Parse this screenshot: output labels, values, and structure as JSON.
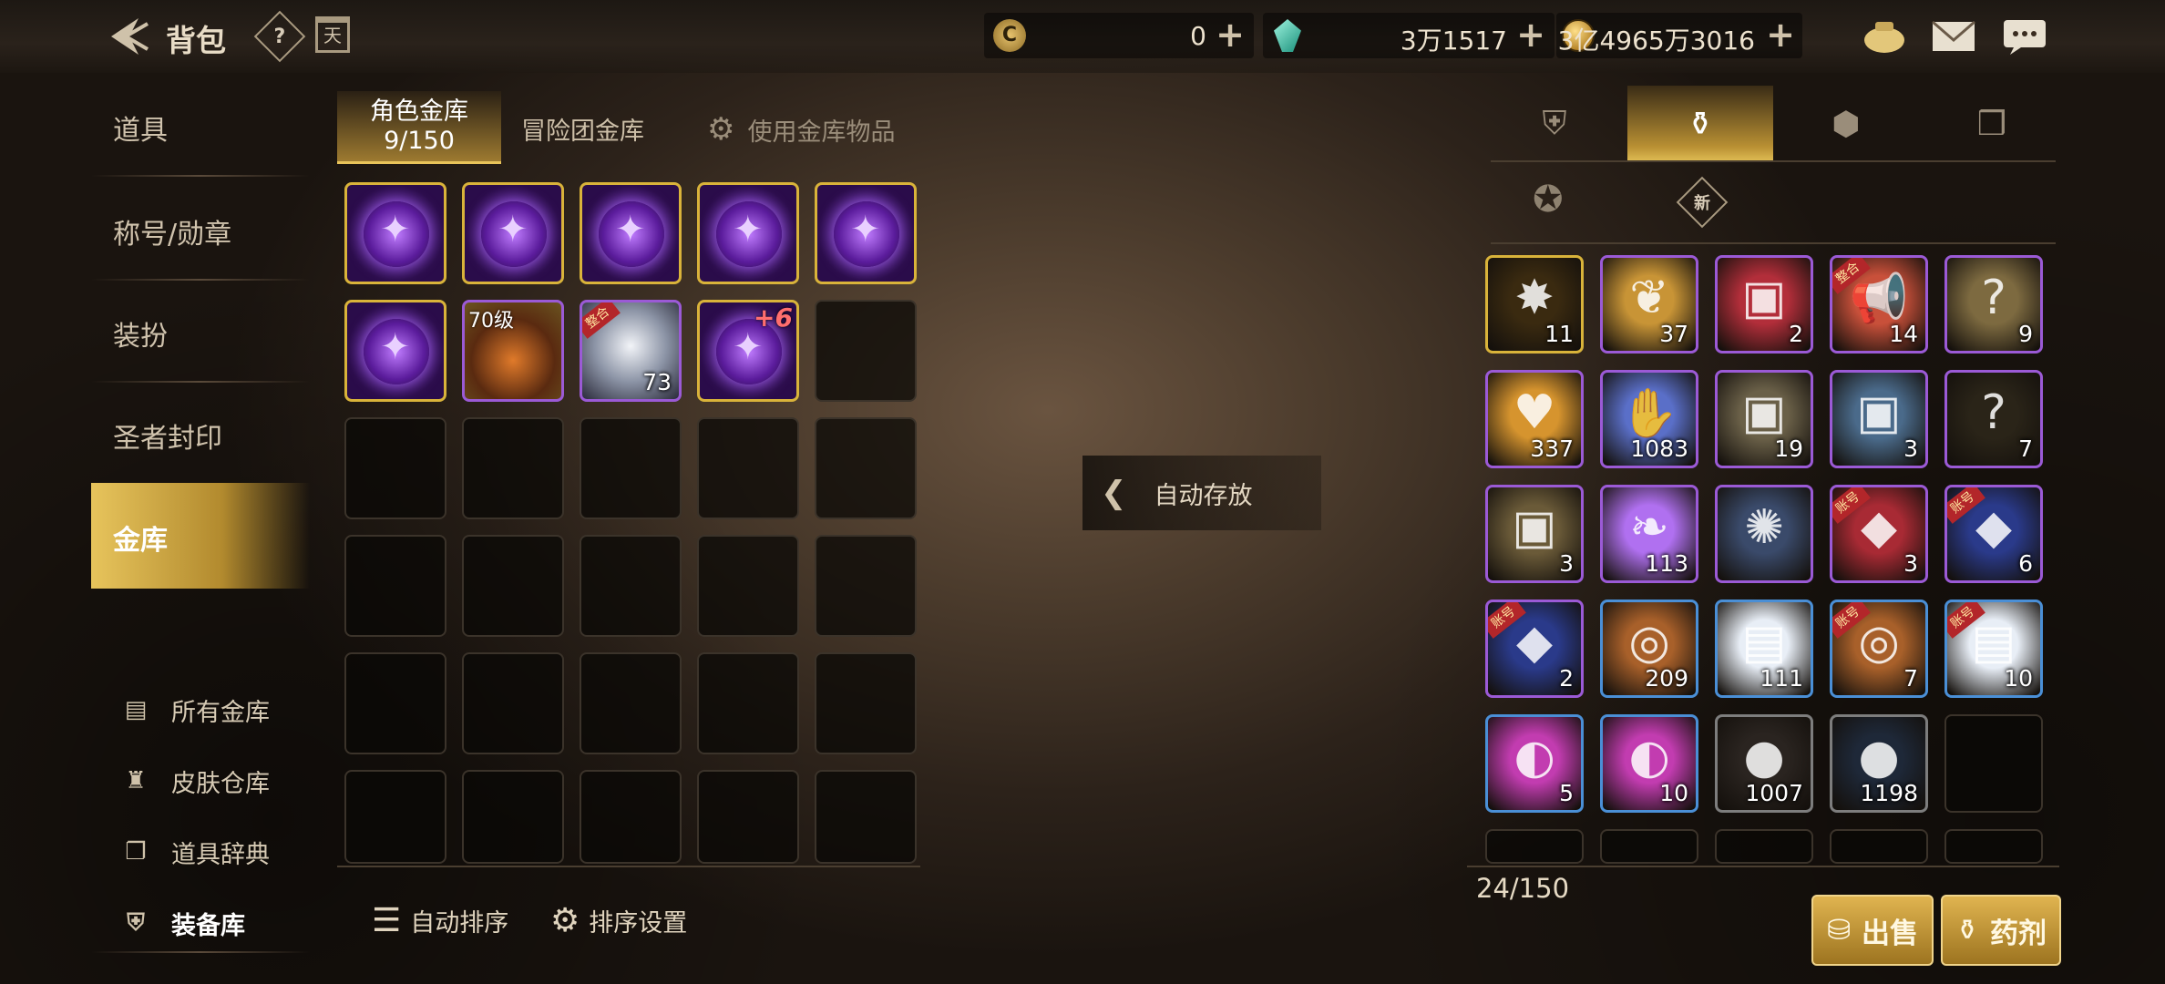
{
  "header": {
    "title": "背包",
    "help_icon": "?",
    "calendar_label": "天"
  },
  "currency": {
    "c_value": "0",
    "gem_value": "3万1517",
    "gold_value": "3亿4965万3016"
  },
  "sidebar": {
    "items": [
      {
        "label": "道具"
      },
      {
        "label": "称号/勋章"
      },
      {
        "label": "装扮"
      },
      {
        "label": "圣者封印"
      },
      {
        "label": "金库"
      }
    ],
    "sub": [
      {
        "label": "所有金库"
      },
      {
        "label": "皮肤仓库"
      },
      {
        "label": "道具辞典"
      },
      {
        "label": "装备库"
      }
    ]
  },
  "vault": {
    "tab_character": "角色金库",
    "tab_character_count": "9/150",
    "tab_team": "冒险团金库",
    "tab_use": "使用金库物品",
    "items": [
      {
        "type": "purple-orb",
        "border": "gold"
      },
      {
        "type": "purple-orb",
        "border": "gold"
      },
      {
        "type": "purple-orb",
        "border": "gold"
      },
      {
        "type": "purple-orb",
        "border": "gold"
      },
      {
        "type": "purple-orb",
        "border": "gold"
      },
      {
        "type": "purple-orb",
        "border": "gold"
      },
      {
        "type": "fire-gem",
        "border": "purple",
        "level": "70级"
      },
      {
        "type": "crystal",
        "border": "purple",
        "count": "73",
        "tag": "整合"
      },
      {
        "type": "purple-orb",
        "border": "gold",
        "plus": "+6"
      }
    ]
  },
  "bottom": {
    "auto_sort": "自动排序",
    "sort_settings": "排序设置"
  },
  "auto_store": "自动存放",
  "inventory": {
    "count": "24/150",
    "sell": "出售",
    "potion": "药剂",
    "items": [
      {
        "color": "#3a2a10",
        "border": "gold",
        "count": "11",
        "sym": "✸"
      },
      {
        "color": "#c89436",
        "border": "purple",
        "count": "37",
        "sym": "❦"
      },
      {
        "color": "#b22e3a",
        "border": "purple",
        "count": "2",
        "sym": "▣"
      },
      {
        "color": "#c8503a",
        "border": "purple",
        "count": "14",
        "sym": "📢",
        "tag": "整合"
      },
      {
        "color": "#7d6a40",
        "border": "purple",
        "count": "9",
        "sym": "?"
      },
      {
        "color": "#d6942e",
        "border": "purple",
        "count": "337",
        "sym": "♥"
      },
      {
        "color": "#5a6fc8",
        "border": "purple",
        "count": "1083",
        "sym": "✋"
      },
      {
        "color": "#6a6048",
        "border": "purple",
        "count": "19",
        "sym": "▣"
      },
      {
        "color": "#4a6a8a",
        "border": "purple",
        "count": "3",
        "sym": "▣"
      },
      {
        "color": "#2a2418",
        "border": "purple",
        "count": "7",
        "sym": "?"
      },
      {
        "color": "#6a5a38",
        "border": "purple",
        "count": "3",
        "sym": "▣"
      },
      {
        "color": "#b070f0",
        "border": "purple",
        "count": "113",
        "sym": "❧"
      },
      {
        "color": "#3a4a6a",
        "border": "purple",
        "count": "",
        "sym": "✺"
      },
      {
        "color": "#a82a34",
        "border": "purple",
        "count": "3",
        "sym": "◆",
        "tag": "账号"
      },
      {
        "color": "#2a3a8a",
        "border": "purple",
        "count": "6",
        "sym": "◆",
        "tag": "账号"
      },
      {
        "color": "#2a3a8a",
        "border": "purple",
        "count": "2",
        "sym": "◆",
        "tag": "账号"
      },
      {
        "color": "#a8602a",
        "border": "blue",
        "count": "209",
        "sym": "◎"
      },
      {
        "color": "#e8eef6",
        "border": "blue",
        "count": "111",
        "sym": "▤"
      },
      {
        "color": "#a8602a",
        "border": "blue",
        "count": "7",
        "sym": "◎",
        "tag": "账号"
      },
      {
        "color": "#e8eef6",
        "border": "blue",
        "count": "10",
        "sym": "▤",
        "tag": "账号"
      },
      {
        "color": "#c23cb0",
        "border": "blue",
        "count": "5",
        "sym": "◐"
      },
      {
        "color": "#c23cb0",
        "border": "blue",
        "count": "10",
        "sym": "◐"
      },
      {
        "color": "#2a2420",
        "border": "gray",
        "count": "1007",
        "sym": "●"
      },
      {
        "color": "#1e2838",
        "border": "gray",
        "count": "1198",
        "sym": "●"
      }
    ]
  }
}
